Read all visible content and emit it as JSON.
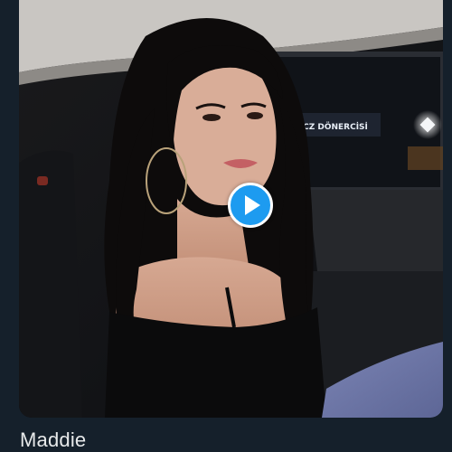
{
  "media": {
    "sign_text": "CZ DÖNERCİSİ",
    "play_icon": "play-icon",
    "accent_color": "#1d9bf0"
  },
  "caption": {
    "name": "Maddie"
  }
}
